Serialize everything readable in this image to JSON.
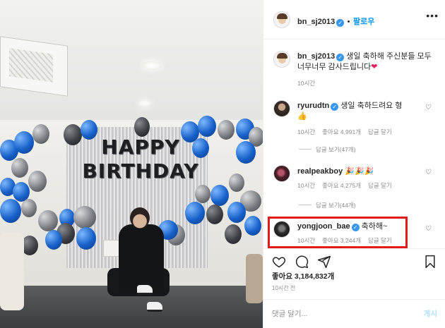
{
  "post": {
    "author": "bn_sj2013",
    "follow_label": "팔로우",
    "separator": "•",
    "more_label": "•••",
    "caption": {
      "author": "bn_sj2013",
      "text": "생일 축하해 주신분들 모두 너무너무 감사드립니다",
      "heart_emoji": "❤",
      "time": "10시간"
    },
    "comments": [
      {
        "user": "ryurudtn",
        "text": "생일 축하드려요 형",
        "emoji": "👍",
        "time": "10시간",
        "likes": "좋아요 4,991개",
        "reply": "답글 달기",
        "view_replies": "답글 보기(47개)"
      },
      {
        "user": "realpeakboy",
        "text": "",
        "emoji": "🎉🎉🎉",
        "time": "10시간",
        "likes": "좋아요 4,275개",
        "reply": "답글 달기",
        "view_replies": "답글 보기(44개)"
      },
      {
        "user": "yongjoon_bae",
        "text": "축하해~",
        "time": "10시간",
        "likes": "좋아요 3,244개",
        "reply": "답글 달기"
      }
    ],
    "like_count": "좋아요 3,184,832개",
    "posted_time": "10시간 전",
    "add_comment_placeholder": "댓글 달기...",
    "post_button": "게시",
    "photo_banner": "HAPPY BIRTHDAY"
  },
  "colors": {
    "link_blue": "#0095f6",
    "verified_blue": "#3897f0",
    "highlight_red": "#e21b1b",
    "muted_grey": "#8e8e8e"
  },
  "icons": [
    "heart-icon",
    "comment-icon",
    "share-icon",
    "bookmark-icon",
    "verified-badge-icon",
    "more-options-icon"
  ]
}
